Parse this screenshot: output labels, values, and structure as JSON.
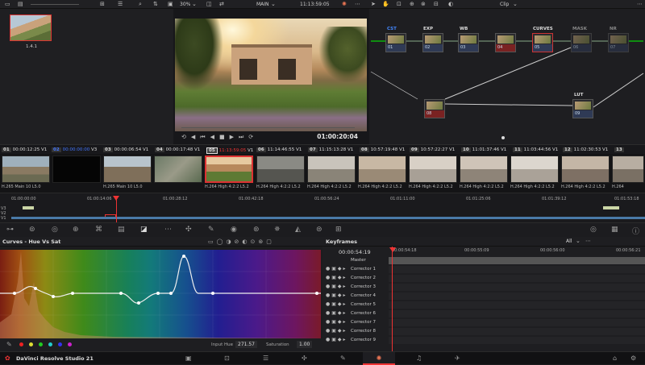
{
  "topbar": {
    "zoom": "30%",
    "viewer_mode": "MAIN",
    "timecode": "11:13:59:05",
    "panel_mode": "Clip"
  },
  "gallery": {
    "still_label": "1.4.1"
  },
  "viewer": {
    "timecode": "01:00:20:04"
  },
  "nodes": [
    {
      "label": "CST",
      "num": "01",
      "state": "normal"
    },
    {
      "label": "EXP",
      "num": "02",
      "state": "normal"
    },
    {
      "label": "WB",
      "num": "03",
      "state": "normal"
    },
    {
      "label": "",
      "num": "04",
      "state": "red"
    },
    {
      "label": "CURVES",
      "num": "05",
      "state": "normal"
    },
    {
      "label": "MASK",
      "num": "06",
      "state": "dim"
    },
    {
      "label": "NR",
      "num": "07",
      "state": "dim"
    },
    {
      "label": "",
      "num": "08",
      "state": "red"
    },
    {
      "label": "LUT",
      "num": "09",
      "state": "normal"
    }
  ],
  "clips": [
    {
      "num": "01",
      "tc": "00:00:12:25",
      "track": "V1",
      "codec": "H.265 Main 10 L5.0"
    },
    {
      "num": "02",
      "tc": "00:00:00:00",
      "track": "V3",
      "codec": ""
    },
    {
      "num": "03",
      "tc": "00:00:06:54",
      "track": "V1",
      "codec": "H.265 Main 10 L5.0"
    },
    {
      "num": "04",
      "tc": "00:00:17:48",
      "track": "V1",
      "codec": ""
    },
    {
      "num": "05",
      "tc": "11:13:59:05",
      "track": "V1",
      "codec": "H.264 High 4:2:2 L5.2"
    },
    {
      "num": "06",
      "tc": "11:14:46:55",
      "track": "V1",
      "codec": "H.264 High 4:2:2 L5.2"
    },
    {
      "num": "07",
      "tc": "11:15:13:28",
      "track": "V1",
      "codec": "H.264 High 4:2:2 L5.2"
    },
    {
      "num": "08",
      "tc": "10:57:19:48",
      "track": "V1",
      "codec": "H.264 High 4:2:2 L5.2"
    },
    {
      "num": "09",
      "tc": "10:57:22:27",
      "track": "V1",
      "codec": "H.264 High 4:2:2 L5.2"
    },
    {
      "num": "10",
      "tc": "11:01:37:46",
      "track": "V1",
      "codec": "H.264 High 4:2:2 L5.2"
    },
    {
      "num": "11",
      "tc": "11:03:44:56",
      "track": "V1",
      "codec": "H.264 High 4:2:2 L5.2"
    },
    {
      "num": "12",
      "tc": "11:02:30:53",
      "track": "V1",
      "codec": "H.264 High 4:2:2 L5.2"
    },
    {
      "num": "13",
      "tc": "",
      "track": "",
      "codec": "H.264"
    }
  ],
  "timeline": {
    "ticks": [
      "01:00:00:00",
      "01:00:14:06",
      "01:00:28:12",
      "01:00:42:18",
      "01:00:56:24",
      "01:01:11:00",
      "01:01:25:06",
      "01:01:39:12",
      "01:01:53:18"
    ],
    "tracks": [
      "V3",
      "V2",
      "V1"
    ]
  },
  "curves": {
    "title": "Curves - Hue Vs Sat",
    "input_hue_label": "Input Hue",
    "input_hue_value": "271.57",
    "saturation_label": "Saturation",
    "saturation_value": "1.00"
  },
  "keyframes": {
    "title": "Keyframes",
    "filter": "All",
    "timecode": "00:00:54:19",
    "ruler": [
      "00:00:54:18",
      "00:00:55:09",
      "00:00:56:00",
      "00:00:56:21"
    ],
    "rows": [
      "Master",
      "Corrector 1",
      "Corrector 2",
      "Corrector 3",
      "Corrector 4",
      "Corrector 5",
      "Corrector 6",
      "Corrector 7",
      "Corrector 8",
      "Corrector 9"
    ]
  },
  "bottom": {
    "app_name": "DaVinci Resolve Studio 21"
  }
}
